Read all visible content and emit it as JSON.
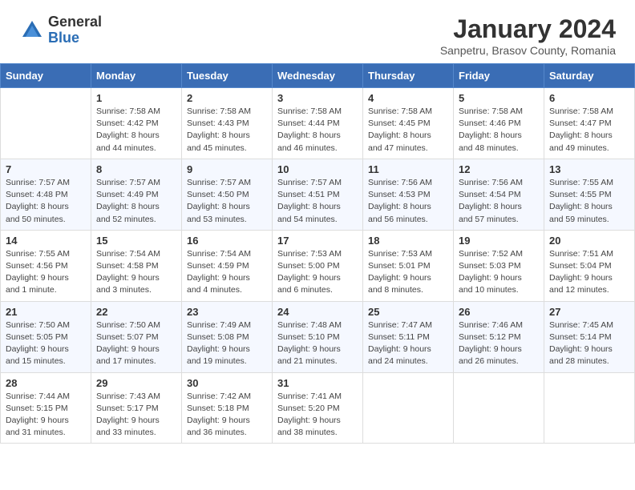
{
  "header": {
    "logo_general": "General",
    "logo_blue": "Blue",
    "month_title": "January 2024",
    "subtitle": "Sanpetru, Brasov County, Romania"
  },
  "weekdays": [
    "Sunday",
    "Monday",
    "Tuesday",
    "Wednesday",
    "Thursday",
    "Friday",
    "Saturday"
  ],
  "weeks": [
    [
      {
        "day": "",
        "info": ""
      },
      {
        "day": "1",
        "info": "Sunrise: 7:58 AM\nSunset: 4:42 PM\nDaylight: 8 hours\nand 44 minutes."
      },
      {
        "day": "2",
        "info": "Sunrise: 7:58 AM\nSunset: 4:43 PM\nDaylight: 8 hours\nand 45 minutes."
      },
      {
        "day": "3",
        "info": "Sunrise: 7:58 AM\nSunset: 4:44 PM\nDaylight: 8 hours\nand 46 minutes."
      },
      {
        "day": "4",
        "info": "Sunrise: 7:58 AM\nSunset: 4:45 PM\nDaylight: 8 hours\nand 47 minutes."
      },
      {
        "day": "5",
        "info": "Sunrise: 7:58 AM\nSunset: 4:46 PM\nDaylight: 8 hours\nand 48 minutes."
      },
      {
        "day": "6",
        "info": "Sunrise: 7:58 AM\nSunset: 4:47 PM\nDaylight: 8 hours\nand 49 minutes."
      }
    ],
    [
      {
        "day": "7",
        "info": "Sunrise: 7:57 AM\nSunset: 4:48 PM\nDaylight: 8 hours\nand 50 minutes."
      },
      {
        "day": "8",
        "info": "Sunrise: 7:57 AM\nSunset: 4:49 PM\nDaylight: 8 hours\nand 52 minutes."
      },
      {
        "day": "9",
        "info": "Sunrise: 7:57 AM\nSunset: 4:50 PM\nDaylight: 8 hours\nand 53 minutes."
      },
      {
        "day": "10",
        "info": "Sunrise: 7:57 AM\nSunset: 4:51 PM\nDaylight: 8 hours\nand 54 minutes."
      },
      {
        "day": "11",
        "info": "Sunrise: 7:56 AM\nSunset: 4:53 PM\nDaylight: 8 hours\nand 56 minutes."
      },
      {
        "day": "12",
        "info": "Sunrise: 7:56 AM\nSunset: 4:54 PM\nDaylight: 8 hours\nand 57 minutes."
      },
      {
        "day": "13",
        "info": "Sunrise: 7:55 AM\nSunset: 4:55 PM\nDaylight: 8 hours\nand 59 minutes."
      }
    ],
    [
      {
        "day": "14",
        "info": "Sunrise: 7:55 AM\nSunset: 4:56 PM\nDaylight: 9 hours\nand 1 minute."
      },
      {
        "day": "15",
        "info": "Sunrise: 7:54 AM\nSunset: 4:58 PM\nDaylight: 9 hours\nand 3 minutes."
      },
      {
        "day": "16",
        "info": "Sunrise: 7:54 AM\nSunset: 4:59 PM\nDaylight: 9 hours\nand 4 minutes."
      },
      {
        "day": "17",
        "info": "Sunrise: 7:53 AM\nSunset: 5:00 PM\nDaylight: 9 hours\nand 6 minutes."
      },
      {
        "day": "18",
        "info": "Sunrise: 7:53 AM\nSunset: 5:01 PM\nDaylight: 9 hours\nand 8 minutes."
      },
      {
        "day": "19",
        "info": "Sunrise: 7:52 AM\nSunset: 5:03 PM\nDaylight: 9 hours\nand 10 minutes."
      },
      {
        "day": "20",
        "info": "Sunrise: 7:51 AM\nSunset: 5:04 PM\nDaylight: 9 hours\nand 12 minutes."
      }
    ],
    [
      {
        "day": "21",
        "info": "Sunrise: 7:50 AM\nSunset: 5:05 PM\nDaylight: 9 hours\nand 15 minutes."
      },
      {
        "day": "22",
        "info": "Sunrise: 7:50 AM\nSunset: 5:07 PM\nDaylight: 9 hours\nand 17 minutes."
      },
      {
        "day": "23",
        "info": "Sunrise: 7:49 AM\nSunset: 5:08 PM\nDaylight: 9 hours\nand 19 minutes."
      },
      {
        "day": "24",
        "info": "Sunrise: 7:48 AM\nSunset: 5:10 PM\nDaylight: 9 hours\nand 21 minutes."
      },
      {
        "day": "25",
        "info": "Sunrise: 7:47 AM\nSunset: 5:11 PM\nDaylight: 9 hours\nand 24 minutes."
      },
      {
        "day": "26",
        "info": "Sunrise: 7:46 AM\nSunset: 5:12 PM\nDaylight: 9 hours\nand 26 minutes."
      },
      {
        "day": "27",
        "info": "Sunrise: 7:45 AM\nSunset: 5:14 PM\nDaylight: 9 hours\nand 28 minutes."
      }
    ],
    [
      {
        "day": "28",
        "info": "Sunrise: 7:44 AM\nSunset: 5:15 PM\nDaylight: 9 hours\nand 31 minutes."
      },
      {
        "day": "29",
        "info": "Sunrise: 7:43 AM\nSunset: 5:17 PM\nDaylight: 9 hours\nand 33 minutes."
      },
      {
        "day": "30",
        "info": "Sunrise: 7:42 AM\nSunset: 5:18 PM\nDaylight: 9 hours\nand 36 minutes."
      },
      {
        "day": "31",
        "info": "Sunrise: 7:41 AM\nSunset: 5:20 PM\nDaylight: 9 hours\nand 38 minutes."
      },
      {
        "day": "",
        "info": ""
      },
      {
        "day": "",
        "info": ""
      },
      {
        "day": "",
        "info": ""
      }
    ]
  ]
}
